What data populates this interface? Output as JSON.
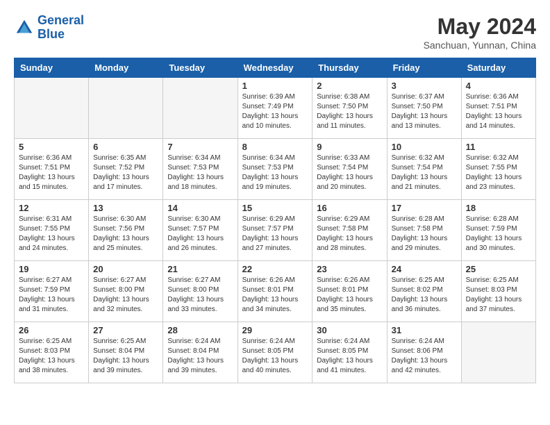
{
  "header": {
    "logo_line1": "General",
    "logo_line2": "Blue",
    "month_title": "May 2024",
    "location": "Sanchuan, Yunnan, China"
  },
  "weekdays": [
    "Sunday",
    "Monday",
    "Tuesday",
    "Wednesday",
    "Thursday",
    "Friday",
    "Saturday"
  ],
  "weeks": [
    [
      {
        "day": "",
        "info": ""
      },
      {
        "day": "",
        "info": ""
      },
      {
        "day": "",
        "info": ""
      },
      {
        "day": "1",
        "info": "Sunrise: 6:39 AM\nSunset: 7:49 PM\nDaylight: 13 hours\nand 10 minutes."
      },
      {
        "day": "2",
        "info": "Sunrise: 6:38 AM\nSunset: 7:50 PM\nDaylight: 13 hours\nand 11 minutes."
      },
      {
        "day": "3",
        "info": "Sunrise: 6:37 AM\nSunset: 7:50 PM\nDaylight: 13 hours\nand 13 minutes."
      },
      {
        "day": "4",
        "info": "Sunrise: 6:36 AM\nSunset: 7:51 PM\nDaylight: 13 hours\nand 14 minutes."
      }
    ],
    [
      {
        "day": "5",
        "info": "Sunrise: 6:36 AM\nSunset: 7:51 PM\nDaylight: 13 hours\nand 15 minutes."
      },
      {
        "day": "6",
        "info": "Sunrise: 6:35 AM\nSunset: 7:52 PM\nDaylight: 13 hours\nand 17 minutes."
      },
      {
        "day": "7",
        "info": "Sunrise: 6:34 AM\nSunset: 7:53 PM\nDaylight: 13 hours\nand 18 minutes."
      },
      {
        "day": "8",
        "info": "Sunrise: 6:34 AM\nSunset: 7:53 PM\nDaylight: 13 hours\nand 19 minutes."
      },
      {
        "day": "9",
        "info": "Sunrise: 6:33 AM\nSunset: 7:54 PM\nDaylight: 13 hours\nand 20 minutes."
      },
      {
        "day": "10",
        "info": "Sunrise: 6:32 AM\nSunset: 7:54 PM\nDaylight: 13 hours\nand 21 minutes."
      },
      {
        "day": "11",
        "info": "Sunrise: 6:32 AM\nSunset: 7:55 PM\nDaylight: 13 hours\nand 23 minutes."
      }
    ],
    [
      {
        "day": "12",
        "info": "Sunrise: 6:31 AM\nSunset: 7:55 PM\nDaylight: 13 hours\nand 24 minutes."
      },
      {
        "day": "13",
        "info": "Sunrise: 6:30 AM\nSunset: 7:56 PM\nDaylight: 13 hours\nand 25 minutes."
      },
      {
        "day": "14",
        "info": "Sunrise: 6:30 AM\nSunset: 7:57 PM\nDaylight: 13 hours\nand 26 minutes."
      },
      {
        "day": "15",
        "info": "Sunrise: 6:29 AM\nSunset: 7:57 PM\nDaylight: 13 hours\nand 27 minutes."
      },
      {
        "day": "16",
        "info": "Sunrise: 6:29 AM\nSunset: 7:58 PM\nDaylight: 13 hours\nand 28 minutes."
      },
      {
        "day": "17",
        "info": "Sunrise: 6:28 AM\nSunset: 7:58 PM\nDaylight: 13 hours\nand 29 minutes."
      },
      {
        "day": "18",
        "info": "Sunrise: 6:28 AM\nSunset: 7:59 PM\nDaylight: 13 hours\nand 30 minutes."
      }
    ],
    [
      {
        "day": "19",
        "info": "Sunrise: 6:27 AM\nSunset: 7:59 PM\nDaylight: 13 hours\nand 31 minutes."
      },
      {
        "day": "20",
        "info": "Sunrise: 6:27 AM\nSunset: 8:00 PM\nDaylight: 13 hours\nand 32 minutes."
      },
      {
        "day": "21",
        "info": "Sunrise: 6:27 AM\nSunset: 8:00 PM\nDaylight: 13 hours\nand 33 minutes."
      },
      {
        "day": "22",
        "info": "Sunrise: 6:26 AM\nSunset: 8:01 PM\nDaylight: 13 hours\nand 34 minutes."
      },
      {
        "day": "23",
        "info": "Sunrise: 6:26 AM\nSunset: 8:01 PM\nDaylight: 13 hours\nand 35 minutes."
      },
      {
        "day": "24",
        "info": "Sunrise: 6:25 AM\nSunset: 8:02 PM\nDaylight: 13 hours\nand 36 minutes."
      },
      {
        "day": "25",
        "info": "Sunrise: 6:25 AM\nSunset: 8:03 PM\nDaylight: 13 hours\nand 37 minutes."
      }
    ],
    [
      {
        "day": "26",
        "info": "Sunrise: 6:25 AM\nSunset: 8:03 PM\nDaylight: 13 hours\nand 38 minutes."
      },
      {
        "day": "27",
        "info": "Sunrise: 6:25 AM\nSunset: 8:04 PM\nDaylight: 13 hours\nand 39 minutes."
      },
      {
        "day": "28",
        "info": "Sunrise: 6:24 AM\nSunset: 8:04 PM\nDaylight: 13 hours\nand 39 minutes."
      },
      {
        "day": "29",
        "info": "Sunrise: 6:24 AM\nSunset: 8:05 PM\nDaylight: 13 hours\nand 40 minutes."
      },
      {
        "day": "30",
        "info": "Sunrise: 6:24 AM\nSunset: 8:05 PM\nDaylight: 13 hours\nand 41 minutes."
      },
      {
        "day": "31",
        "info": "Sunrise: 6:24 AM\nSunset: 8:06 PM\nDaylight: 13 hours\nand 42 minutes."
      },
      {
        "day": "",
        "info": ""
      }
    ]
  ]
}
